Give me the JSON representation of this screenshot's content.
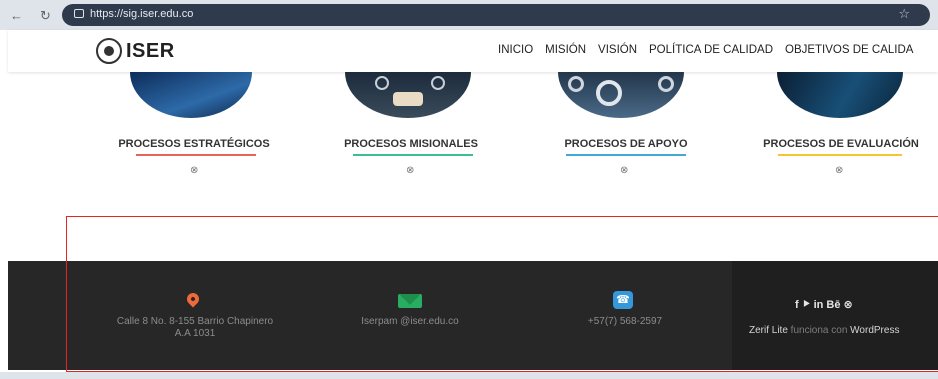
{
  "browser": {
    "url": "https://sig.iser.edu.co",
    "back_icon": "arrow-left",
    "reload_icon": "reload",
    "star_icon": "star"
  },
  "header": {
    "logo_text": "ISER",
    "menu": [
      "INICIO",
      "MISIÓN",
      "VISIÓN",
      "POLÍTICA DE CALIDAD",
      "OBJETIVOS DE CALIDA"
    ]
  },
  "processes": [
    {
      "title": "PROCESOS ESTRATÉGICOS",
      "color": "#e8635a",
      "icon": "⊗"
    },
    {
      "title": "PROCESOS MISIONALES",
      "color": "#3bbf8f",
      "icon": "⊗"
    },
    {
      "title": "PROCESOS DE APOYO",
      "color": "#42a8d8",
      "icon": "⊗"
    },
    {
      "title": "PROCESOS DE EVALUACIÓN",
      "color": "#f4c531",
      "icon": "⊗"
    }
  ],
  "footer": {
    "address": "Calle 8 No. 8-155 Barrio Chapinero",
    "address2": "A.A 1031",
    "email": "Iserpam @iser.edu.co",
    "phone": "+57(7) 568-2597",
    "social": "f  ⯈  in  Bē  ⊗",
    "credit_brand": "Zerif Lite",
    "credit_mid": " funciona con ",
    "credit_wp": "WordPress"
  },
  "colors": {
    "address_icon": "#ef6a3b",
    "email_icon": "#27ae60",
    "phone_icon": "#3498db",
    "highlight_box": "#e32525"
  }
}
